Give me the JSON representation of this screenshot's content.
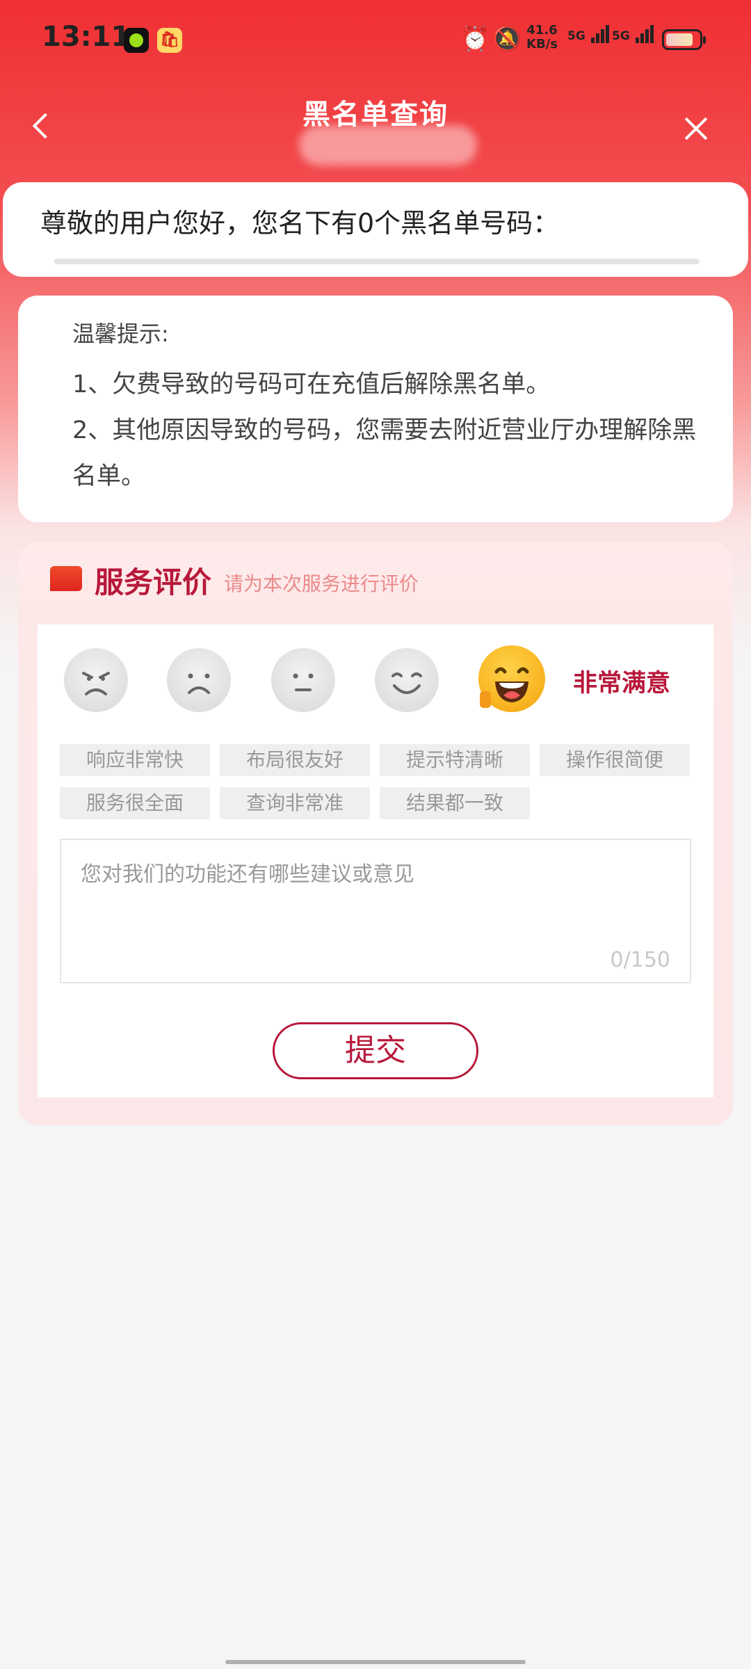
{
  "status_bar": {
    "time": "13:11",
    "net_speed_value": "41.6",
    "net_speed_unit": "KB/s",
    "sim1": "5G",
    "sim2": "5G"
  },
  "nav": {
    "title": "黑名单查询"
  },
  "blacklist": {
    "message": "尊敬的用户您好，您名下有0个黑名单号码："
  },
  "tips": {
    "title": "温馨提示:",
    "items": [
      "1、欠费导致的号码可在充值后解除黑名单。",
      "2、其他原因导致的号码，您需要去附近营业厅办理解除黑名单。"
    ]
  },
  "rating": {
    "title": "服务评价",
    "subtitle": "请为本次服务进行评价",
    "faces": [
      "angry-face-icon",
      "sad-face-icon",
      "neutral-face-icon",
      "smile-face-icon",
      "laughing-face-icon"
    ],
    "selected_label": "非常满意",
    "tags": [
      "响应非常快",
      "布局很友好",
      "提示特清晰",
      "操作很简便",
      "服务很全面",
      "查询非常准",
      "结果都一致"
    ],
    "suggestion_placeholder": "您对我们的功能还有哪些建议或意见",
    "char_count": "0/150",
    "submit_label": "提交"
  },
  "colors": {
    "header_red": "#ef2f33",
    "accent": "#b8183a",
    "selected_face": "#ffc72c"
  }
}
